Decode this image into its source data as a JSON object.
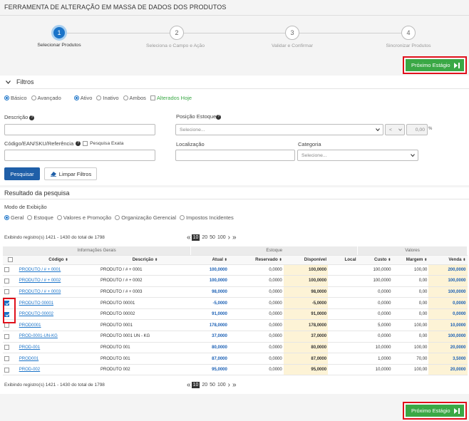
{
  "page": {
    "title": "FERRAMENTA DE ALTERAÇÃO EM MASSA DE DADOS DOS PRODUTOS"
  },
  "steps": [
    {
      "number": "1",
      "label": "Selecionar Produtos",
      "active": true
    },
    {
      "number": "2",
      "label": "Seleciona o Campo e Ação",
      "active": false
    },
    {
      "number": "3",
      "label": "Validar e Confirmar",
      "active": false
    },
    {
      "number": "4",
      "label": "Sincronizar Produtos",
      "active": false
    }
  ],
  "next_button": {
    "label": "Próximo Estágio"
  },
  "filters": {
    "title": "Filtros",
    "mode_options": [
      "Básico",
      "Avançado"
    ],
    "status_options": [
      "Ativo",
      "Inativo",
      "Ambos"
    ],
    "altered_today": "Alterados Hoje",
    "descricao_label": "Descrição",
    "codigo_label": "Código/EAN/SKU/Referência",
    "exact_search": "Pesquisa Exata",
    "posicao_label": "Posição Estoque",
    "posicao_placeholder": "Selecione...",
    "operator": "<",
    "posicao_value": "0,00",
    "percent": "%",
    "localizacao_label": "Localização",
    "categoria_label": "Categoria",
    "categoria_placeholder": "Selecione...",
    "search_button": "Pesquisar",
    "clear_button": "Limpar Filtros"
  },
  "results": {
    "title": "Resultado da pesquisa",
    "view_mode_label": "Modo de Exibição",
    "view_modes": [
      "Geral",
      "Estoque",
      "Valores e Promoção",
      "Organização Gerencial",
      "Impostos Incidentes"
    ],
    "records_info": "Exibindo registro(s) 1421 - 1430 do total de 1798",
    "pager": {
      "first": "«",
      "prev": "‹",
      "sizes": [
        "10",
        "20",
        "50",
        "100"
      ],
      "next": "›",
      "last": "»"
    },
    "group_headers": [
      "Informações Gerais",
      "Estoque",
      "Valores"
    ],
    "columns": [
      "Código",
      "Descrição",
      "Atual",
      "Reservado",
      "Disponível",
      "Local",
      "Custo",
      "Margem",
      "Venda"
    ],
    "rows": [
      {
        "checked": false,
        "codigo": "PRODUTO / # + 0001",
        "descricao": "PRODUTO / # + 0001",
        "atual": "100,0000",
        "reservado": "0,0000",
        "disponivel": "100,0000",
        "local": "",
        "custo": "100,0000",
        "margem": "100,00",
        "venda": "200,0000"
      },
      {
        "checked": false,
        "codigo": "PRODUTO / # + 0002",
        "descricao": "PRODUTO / # + 0002",
        "atual": "100,0000",
        "reservado": "0,0000",
        "disponivel": "100,0000",
        "local": "",
        "custo": "100,0000",
        "margem": "0,00",
        "venda": "100,0000"
      },
      {
        "checked": false,
        "codigo": "PRODUTO / # + 0003",
        "descricao": "PRODUTO / # + 0003",
        "atual": "98,0000",
        "reservado": "0,0000",
        "disponivel": "98,0000",
        "local": "",
        "custo": "0,0000",
        "margem": "0,00",
        "venda": "100,0000"
      },
      {
        "checked": true,
        "codigo": "PRODUTO 00001",
        "descricao": "PRODUTO 00001",
        "atual": "-5,0000",
        "reservado": "0,0000",
        "disponivel": "-5,0000",
        "local": "",
        "custo": "0,0000",
        "margem": "0,00",
        "venda": "0,0000"
      },
      {
        "checked": true,
        "codigo": "PRODUTO 00002",
        "descricao": "PRODUTO 00002",
        "atual": "91,0000",
        "reservado": "0,0000",
        "disponivel": "91,0000",
        "local": "",
        "custo": "0,0000",
        "margem": "0,00",
        "venda": "0,0000"
      },
      {
        "checked": false,
        "codigo": "PROD0001",
        "descricao": "PRODUTO 0001",
        "atual": "178,0000",
        "reservado": "0,0000",
        "disponivel": "178,0000",
        "local": "",
        "custo": "5,0000",
        "margem": "100,00",
        "venda": "10,0000"
      },
      {
        "checked": false,
        "codigo": "PROD-0001-UN-KG",
        "descricao": "PRODUTO 0001 UN - KG",
        "atual": "37,0000",
        "reservado": "0,0000",
        "disponivel": "37,0000",
        "local": "",
        "custo": "0,0000",
        "margem": "0,00",
        "venda": "100,0000"
      },
      {
        "checked": false,
        "codigo": "PROD-001",
        "descricao": "PRODUTO 001",
        "atual": "80,0000",
        "reservado": "0,0000",
        "disponivel": "80,0000",
        "local": "",
        "custo": "10,0000",
        "margem": "100,00",
        "venda": "20,0000"
      },
      {
        "checked": false,
        "codigo": "PROD001",
        "descricao": "PRODUTO 001",
        "atual": "87,0000",
        "reservado": "0,0000",
        "disponivel": "87,0000",
        "local": "",
        "custo": "1,0000",
        "margem": "70,00",
        "venda": "3,5000"
      },
      {
        "checked": false,
        "codigo": "PROD-002",
        "descricao": "PRODUTO 002",
        "atual": "95,0000",
        "reservado": "0,0000",
        "disponivel": "95,0000",
        "local": "",
        "custo": "10,0000",
        "margem": "100,00",
        "venda": "20,0000"
      }
    ]
  },
  "colors": {
    "accent": "#1a73c8",
    "next": "#3aa845",
    "highlight": "#e0101b"
  },
  "icons": [
    "question-icon",
    "chevron-down-icon",
    "eraser-icon",
    "sort-icon",
    "play-end-icon"
  ]
}
